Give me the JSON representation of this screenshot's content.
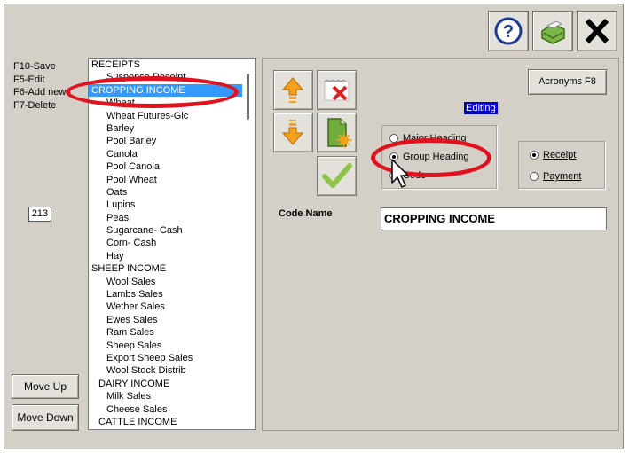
{
  "shortcuts": [
    "F10-Save",
    "F5-Edit",
    "F6-Add new",
    "F7-Delete"
  ],
  "record_count": "213",
  "buttons": {
    "move_up": "Move Up",
    "move_down": "Move Down",
    "acronyms": "Acronyms F8"
  },
  "tree": [
    {
      "label": "RECEIPTS",
      "level": 0
    },
    {
      "label": "Suspense Receipt",
      "level": 1
    },
    {
      "label": "CROPPING INCOME",
      "level": 0,
      "selected": true
    },
    {
      "label": "Wheat",
      "level": 1
    },
    {
      "label": "Wheat Futures-Gic",
      "level": 1
    },
    {
      "label": "Barley",
      "level": 1
    },
    {
      "label": "Pool Barley",
      "level": 1
    },
    {
      "label": "Canola",
      "level": 1
    },
    {
      "label": "Pool Canola",
      "level": 1
    },
    {
      "label": "Pool Wheat",
      "level": 1
    },
    {
      "label": "Oats",
      "level": 1
    },
    {
      "label": "Lupins",
      "level": 1
    },
    {
      "label": "Peas",
      "level": 1
    },
    {
      "label": "Sugarcane- Cash",
      "level": 1
    },
    {
      "label": "Corn- Cash",
      "level": 1
    },
    {
      "label": "Hay",
      "level": 1
    },
    {
      "label": "SHEEP INCOME",
      "level": 0
    },
    {
      "label": "Wool Sales",
      "level": 1
    },
    {
      "label": "Lambs Sales",
      "level": 1
    },
    {
      "label": "Wether Sales",
      "level": 1
    },
    {
      "label": "Ewes Sales",
      "level": 1
    },
    {
      "label": "Ram Sales",
      "level": 1
    },
    {
      "label": "Sheep Sales",
      "level": 1
    },
    {
      "label": "Export Sheep Sales",
      "level": 1
    },
    {
      "label": "Wool Stock Distrib",
      "level": 1
    },
    {
      "label": "DAIRY INCOME",
      "level": 2
    },
    {
      "label": "Milk Sales",
      "level": 1
    },
    {
      "label": "Cheese Sales",
      "level": 1
    },
    {
      "label": "CATTLE INCOME",
      "level": 2
    }
  ],
  "status": "Editing",
  "heading_type": {
    "options": [
      {
        "label": "Major Heading",
        "checked": false
      },
      {
        "label": "Group Heading",
        "checked": true
      },
      {
        "label": "Code",
        "checked": false
      }
    ]
  },
  "transaction_type": {
    "options": [
      {
        "label": "Receipt",
        "checked": true
      },
      {
        "label": "Payment",
        "checked": false
      }
    ]
  },
  "code_name": {
    "label": "Code Name",
    "value": "CROPPING INCOME"
  },
  "colors": {
    "selection": "#3399ff",
    "highlight_ellipse": "#e0121e",
    "editing_badge": "#0000cc"
  }
}
